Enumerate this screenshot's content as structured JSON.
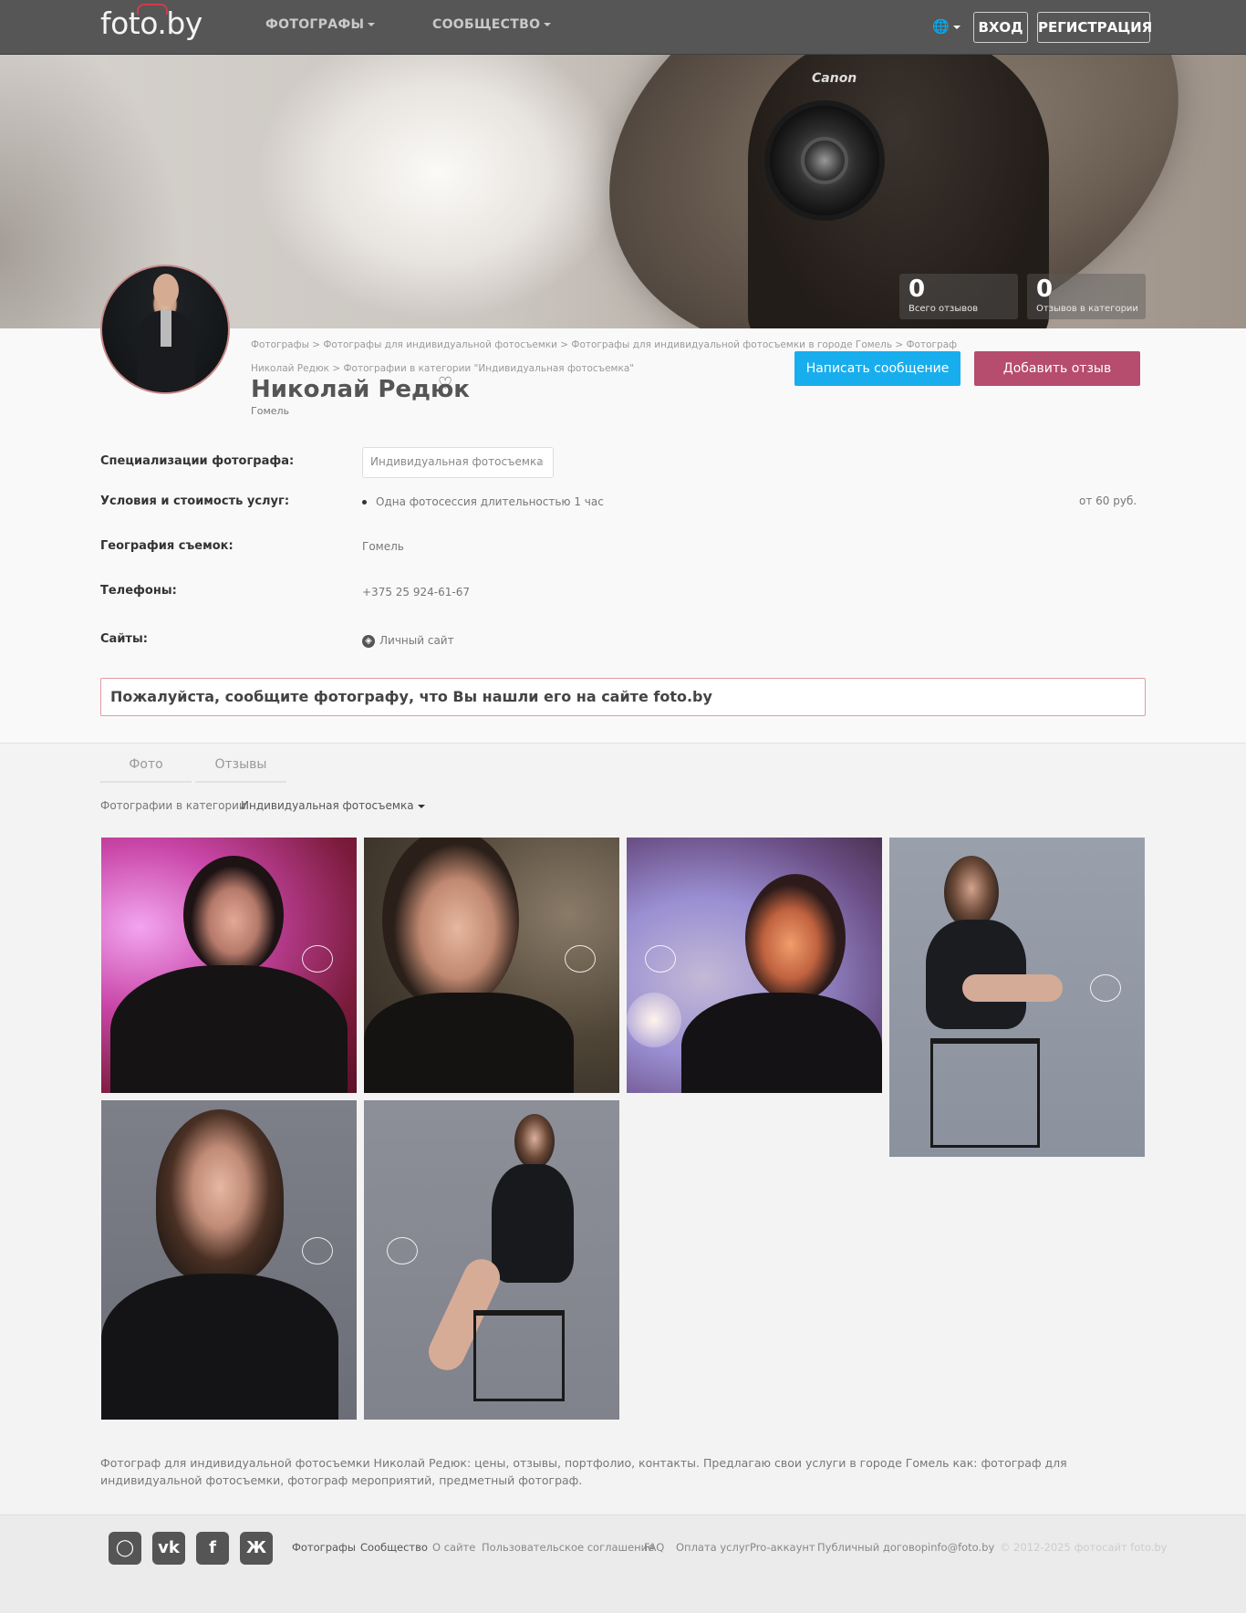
{
  "header": {
    "logo": "foto.by",
    "nav": [
      "ФОТОГРАФЫ",
      "СООБЩЕСТВО"
    ],
    "login": "ВХОД",
    "register": "РЕГИСТРАЦИЯ"
  },
  "hero": {
    "camera_brand": "Canon",
    "stats": [
      {
        "value": "0",
        "label": "Всего отзывов"
      },
      {
        "value": "0",
        "label": "Отзывов в категории"
      }
    ]
  },
  "profile": {
    "breadcrumb": "Фотографы > Фотографы для индивидуальной фотосъемки > Фотографы для индивидуальной фотосъемки в городе Гомель > Фотограф Николай Редюк > Фотографии в категории \"Индивидуальная фотосъемка\"",
    "name": "Николай Редюк",
    "city": "Гомель",
    "write_message": "Написать сообщение",
    "add_review": "Добавить отзыв",
    "rows": {
      "spec_label": "Специализации фотографа:",
      "spec_value": "Индивидуальная фотосъемка",
      "terms_label": "Условия и стоимость услуг:",
      "terms_value": "Одна фотосессия длительностью 1 час",
      "terms_price": "от 60 руб.",
      "geo_label": "География съемок:",
      "geo_value": "Гомель",
      "phones_label": "Телефоны:",
      "phones_value": "+375 25 924-61-67",
      "sites_label": "Сайты:",
      "sites_value": "Личный сайт"
    },
    "notice": "Пожалуйста, сообщите фотографу, что Вы нашли его на сайте foto.by"
  },
  "gallery": {
    "tabs": [
      "Фото",
      "Отзывы"
    ],
    "filter_label": "Фотографии в категории",
    "filter_value": "Индивидуальная фотосъемка"
  },
  "seo_text": "Фотограф для индивидуальной фотосъемки Николай Редюк: цены, отзывы, портфолио, контакты. Предлагаю свои услуги в городе Гомель как: фотограф для индивидуальной фотосъемки, фотограф мероприятий, предметный фотограф.",
  "footer": {
    "social": [
      "instagram-icon",
      "vk-icon",
      "facebook-icon",
      "odnoklassniki-icon"
    ],
    "links": [
      "Фотографы",
      "Сообщество",
      "О сайте",
      "Пользовательское соглашение",
      "FAQ",
      "Оплата услуг",
      "Pro-аккаунт",
      "Публичный договор",
      "info@foto.by"
    ],
    "copyright": "© 2012-2025 фотосайт foto.by"
  }
}
